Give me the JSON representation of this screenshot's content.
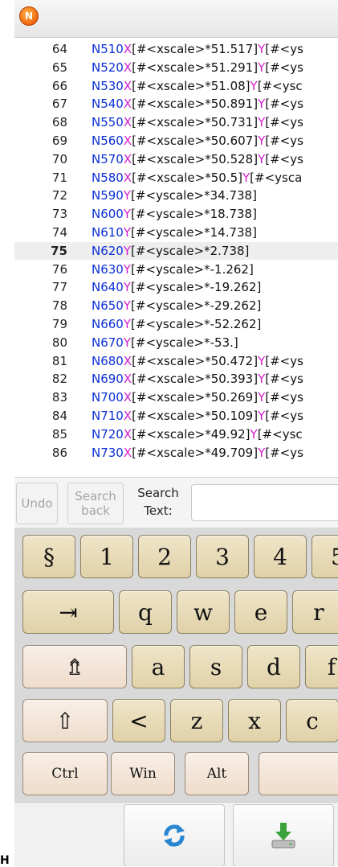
{
  "editor": {
    "current_line_index": 11,
    "lines": [
      {
        "num": "64",
        "n": "N510",
        "x": "X",
        "xexpr": "[#<xscale>*51.517]",
        "y": "Y",
        "yexpr": "[#<ys"
      },
      {
        "num": "65",
        "n": "N520",
        "x": "X",
        "xexpr": "[#<xscale>*51.291]",
        "y": "Y",
        "yexpr": "[#<ys"
      },
      {
        "num": "66",
        "n": "N530",
        "x": "X",
        "xexpr": "[#<xscale>*51.08]",
        "y": "Y",
        "yexpr": "[#<ysc"
      },
      {
        "num": "67",
        "n": "N540",
        "x": "X",
        "xexpr": "[#<xscale>*50.891]",
        "y": "Y",
        "yexpr": "[#<ys"
      },
      {
        "num": "68",
        "n": "N550",
        "x": "X",
        "xexpr": "[#<xscale>*50.731]",
        "y": "Y",
        "yexpr": "[#<ys"
      },
      {
        "num": "69",
        "n": "N560",
        "x": "X",
        "xexpr": "[#<xscale>*50.607]",
        "y": "Y",
        "yexpr": "[#<ys"
      },
      {
        "num": "70",
        "n": "N570",
        "x": "X",
        "xexpr": "[#<xscale>*50.528]",
        "y": "Y",
        "yexpr": "[#<ys"
      },
      {
        "num": "71",
        "n": "N580",
        "x": "X",
        "xexpr": "[#<xscale>*50.5]",
        "y": "Y",
        "yexpr": "[#<ysca"
      },
      {
        "num": "72",
        "n": "N590",
        "x": "",
        "xexpr": "",
        "y": "Y",
        "yexpr": "[#<yscale>*34.738]"
      },
      {
        "num": "73",
        "n": "N600",
        "x": "",
        "xexpr": "",
        "y": "Y",
        "yexpr": "[#<yscale>*18.738]"
      },
      {
        "num": "74",
        "n": "N610",
        "x": "",
        "xexpr": "",
        "y": "Y",
        "yexpr": "[#<yscale>*14.738]"
      },
      {
        "num": "75",
        "n": "N620",
        "x": "",
        "xexpr": "",
        "y": "Y",
        "yexpr": "[#<yscale>*2.738]"
      },
      {
        "num": "76",
        "n": "N630",
        "x": "",
        "xexpr": "",
        "y": "Y",
        "yexpr": "[#<yscale>*-1.262]"
      },
      {
        "num": "77",
        "n": "N640",
        "x": "",
        "xexpr": "",
        "y": "Y",
        "yexpr": "[#<yscale>*-19.262]"
      },
      {
        "num": "78",
        "n": "N650",
        "x": "",
        "xexpr": "",
        "y": "Y",
        "yexpr": "[#<yscale>*-29.262]"
      },
      {
        "num": "79",
        "n": "N660",
        "x": "",
        "xexpr": "",
        "y": "Y",
        "yexpr": "[#<yscale>*-52.262]"
      },
      {
        "num": "80",
        "n": "N670",
        "x": "",
        "xexpr": "",
        "y": "Y",
        "yexpr": "[#<yscale>*-53.]"
      },
      {
        "num": "81",
        "n": "N680",
        "x": "X",
        "xexpr": "[#<xscale>*50.472]",
        "y": "Y",
        "yexpr": "[#<ys"
      },
      {
        "num": "82",
        "n": "N690",
        "x": "X",
        "xexpr": "[#<xscale>*50.393]",
        "y": "Y",
        "yexpr": "[#<ys"
      },
      {
        "num": "83",
        "n": "N700",
        "x": "X",
        "xexpr": "[#<xscale>*50.269]",
        "y": "Y",
        "yexpr": "[#<ys"
      },
      {
        "num": "84",
        "n": "N710",
        "x": "X",
        "xexpr": "[#<xscale>*50.109]",
        "y": "Y",
        "yexpr": "[#<ys"
      },
      {
        "num": "85",
        "n": "N720",
        "x": "X",
        "xexpr": "[#<xscale>*49.92]",
        "y": "Y",
        "yexpr": "[#<ysc"
      },
      {
        "num": "86",
        "n": "N730",
        "x": "X",
        "xexpr": "[#<xscale>*49.709]",
        "y": "Y",
        "yexpr": "[#<ys"
      }
    ]
  },
  "search": {
    "undo_label": "Undo",
    "search_back_label": "Search back",
    "search_text_label": "Search Text:",
    "input_value": ""
  },
  "keyboard": {
    "rows": [
      [
        "§",
        "1",
        "2",
        "3",
        "4",
        "5"
      ],
      [
        "⇥",
        "q",
        "w",
        "e",
        "r"
      ],
      [
        "⇯",
        "a",
        "s",
        "d",
        "f"
      ],
      [
        "⇧",
        "<",
        "z",
        "x",
        "c"
      ],
      [
        "Ctrl",
        "Win",
        "Alt",
        ""
      ]
    ]
  },
  "bottom_bar": {
    "refresh_icon": "refresh-icon",
    "download_icon": "download-drive-icon"
  },
  "stray_glyph": "H",
  "colors": {
    "n_word": "#0a2fd6",
    "axis_letter": "#d41ecf",
    "bracket": "#1aa0c8",
    "key_face": "#e6d9b4",
    "modifier_face": "#f3e4d6"
  }
}
